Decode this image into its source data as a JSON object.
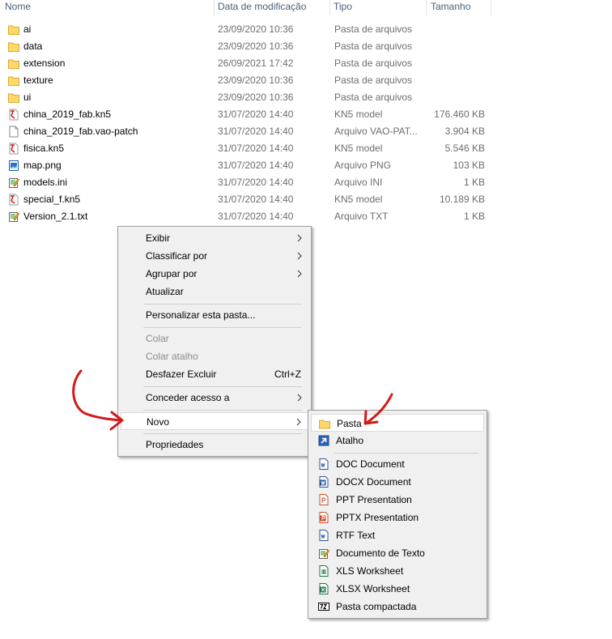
{
  "columns": {
    "name": "Nome",
    "date": "Data de modificação",
    "type": "Tipo",
    "size": "Tamanho"
  },
  "files": [
    {
      "name": "ai",
      "date": "23/09/2020 10:36",
      "type": "Pasta de arquivos",
      "size": "",
      "icon": "folder-icon"
    },
    {
      "name": "data",
      "date": "23/09/2020 10:36",
      "type": "Pasta de arquivos",
      "size": "",
      "icon": "folder-icon"
    },
    {
      "name": "extension",
      "date": "26/09/2021 17:42",
      "type": "Pasta de arquivos",
      "size": "",
      "icon": "folder-icon"
    },
    {
      "name": "texture",
      "date": "23/09/2020 10:36",
      "type": "Pasta de arquivos",
      "size": "",
      "icon": "folder-icon"
    },
    {
      "name": "ui",
      "date": "23/09/2020 10:36",
      "type": "Pasta de arquivos",
      "size": "",
      "icon": "folder-icon"
    },
    {
      "name": "china_2019_fab.kn5",
      "date": "31/07/2020 14:40",
      "type": "KN5 model",
      "size": "176.460 KB",
      "icon": "kn5-file-icon"
    },
    {
      "name": "china_2019_fab.vao-patch",
      "date": "31/07/2020 14:40",
      "type": "Arquivo VAO-PAT...",
      "size": "3.904 KB",
      "icon": "blank-file-icon"
    },
    {
      "name": "fisica.kn5",
      "date": "31/07/2020 14:40",
      "type": "KN5 model",
      "size": "5.546 KB",
      "icon": "kn5-file-icon"
    },
    {
      "name": "map.png",
      "date": "31/07/2020 14:40",
      "type": "Arquivo PNG",
      "size": "103 KB",
      "icon": "image-file-icon"
    },
    {
      "name": "models.ini",
      "date": "31/07/2020 14:40",
      "type": "Arquivo INI",
      "size": "1 KB",
      "icon": "ini-file-icon"
    },
    {
      "name": "special_f.kn5",
      "date": "31/07/2020 14:40",
      "type": "KN5 model",
      "size": "10.189 KB",
      "icon": "kn5-file-icon"
    },
    {
      "name": "Version_2.1.txt",
      "date": "31/07/2020 14:40",
      "type": "Arquivo TXT",
      "size": "1 KB",
      "icon": "text-file-icon"
    }
  ],
  "context_menu": {
    "view": "Exibir",
    "sort_by": "Classificar por",
    "group_by": "Agrupar por",
    "refresh": "Atualizar",
    "customize_folder": "Personalizar esta pasta...",
    "paste": "Colar",
    "paste_shortcut": "Colar atalho",
    "undo_delete": "Desfazer Excluir",
    "undo_delete_key": "Ctrl+Z",
    "give_access": "Conceder acesso a",
    "new": "Novo",
    "properties": "Propriedades"
  },
  "new_submenu": {
    "folder": "Pasta",
    "shortcut": "Atalho",
    "doc": "DOC Document",
    "docx": "DOCX Document",
    "ppt": "PPT Presentation",
    "pptx": "PPTX Presentation",
    "rtf": "RTF Text",
    "txt": "Documento de Texto",
    "xls": "XLS Worksheet",
    "xlsx": "XLSX Worksheet",
    "zip": "Pasta compactada"
  },
  "colors": {
    "annotation_arrow": "#d11a1a",
    "folder_yellow": "#ffd867",
    "menu_background": "#f0f0f0"
  }
}
